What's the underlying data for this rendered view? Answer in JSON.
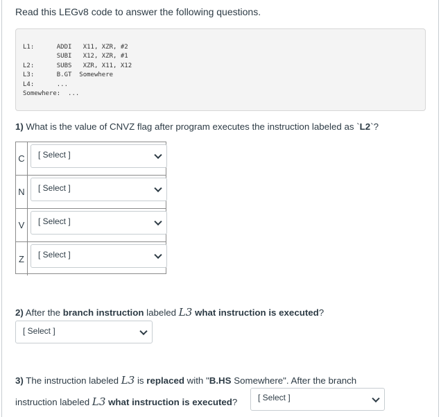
{
  "intro": "Read this LEGv8 code to answer the following questions.",
  "code_lines": [
    "L1:      ADDI   X11, XZR, #2",
    "         SUBI   X12, XZR, #1",
    "L2:      SUBS   XZR, X11, X12",
    "L3:      B.GT  Somewhere",
    "L4:      ...",
    "Somewhere:  ..."
  ],
  "q1": {
    "number": "1)",
    "text": " What is the value of CNVZ flag after program executes the instruction labeled as `",
    "label": "L2",
    "end": "`?",
    "flags": [
      {
        "flag": "C",
        "selected": "[ Select ]"
      },
      {
        "flag": "N",
        "selected": "[ Select ]"
      },
      {
        "flag": "V",
        "selected": "[ Select ]"
      },
      {
        "flag": "Z",
        "selected": "[ Select ]"
      }
    ]
  },
  "q2": {
    "number": "2)",
    "t1": " After the ",
    "t2": "branch instruction",
    "t3": " labeled ",
    "math": "L3",
    "t4": " what instruction is executed",
    "t5": "?",
    "selected": "[ Select ]"
  },
  "q3": {
    "number": "3)",
    "t1": " The instruction labeled ",
    "math": "L3",
    "t2": " is ",
    "t3": "replaced",
    "t4": " with \"",
    "t5": "B.HS",
    "t6": " Somewhere\". After the branch",
    "l2a": "instruction labeled ",
    "math2": "L3",
    "l2b": " what instruction is executed",
    "l2c": "?",
    "selected": "[ Select ]"
  }
}
